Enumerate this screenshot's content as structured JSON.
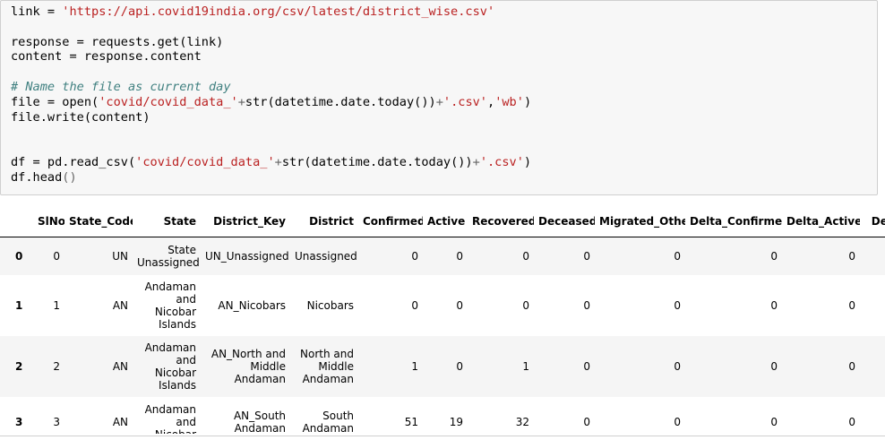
{
  "code_cell": {
    "lines": [
      [
        {
          "t": "link = ",
          "c": ""
        },
        {
          "t": "'https://api.covid19india.org/csv/latest/district_wise.csv'",
          "c": "str"
        }
      ],
      [],
      [
        {
          "t": "response = requests.get(link)",
          "c": ""
        }
      ],
      [
        {
          "t": "content = response.content",
          "c": ""
        }
      ],
      [],
      [
        {
          "t": "# Name the file as current day",
          "c": "com"
        }
      ],
      [
        {
          "t": "file = open(",
          "c": ""
        },
        {
          "t": "'covid/covid_data_'",
          "c": "str"
        },
        {
          "t": "+",
          "c": "op"
        },
        {
          "t": "str(datetime.date.today())",
          "c": ""
        },
        {
          "t": "+",
          "c": "op"
        },
        {
          "t": "'.csv'",
          "c": "str"
        },
        {
          "t": ",",
          "c": ""
        },
        {
          "t": "'wb'",
          "c": "str"
        },
        {
          "t": ")",
          "c": ""
        }
      ],
      [
        {
          "t": "file.write(content)",
          "c": ""
        }
      ],
      [],
      [],
      [
        {
          "t": "df = pd.read_csv(",
          "c": ""
        },
        {
          "t": "'covid/covid_data_'",
          "c": "str"
        },
        {
          "t": "+",
          "c": "op"
        },
        {
          "t": "str(datetime.date.today())",
          "c": ""
        },
        {
          "t": "+",
          "c": "op"
        },
        {
          "t": "'.csv'",
          "c": "str"
        },
        {
          "t": ")",
          "c": ""
        }
      ],
      [
        {
          "t": "df.head",
          "c": ""
        },
        {
          "t": "()",
          "c": "op"
        }
      ]
    ]
  },
  "table": {
    "columns": [
      "",
      "SlNo",
      "State_Code",
      "State",
      "District_Key",
      "District",
      "Confirmed",
      "Active",
      "Recovered",
      "Deceased",
      "Migrated_Other",
      "Delta_Confirmed",
      "Delta_Active",
      "Del"
    ],
    "rows": [
      {
        "index": "0",
        "cells": [
          "0",
          "UN",
          "State Unassigned",
          "UN_Unassigned",
          "Unassigned",
          "0",
          "0",
          "0",
          "0",
          "0",
          "0",
          "0",
          ""
        ]
      },
      {
        "index": "1",
        "cells": [
          "1",
          "AN",
          "Andaman and Nicobar Islands",
          "AN_Nicobars",
          "Nicobars",
          "0",
          "0",
          "0",
          "0",
          "0",
          "0",
          "0",
          ""
        ]
      },
      {
        "index": "2",
        "cells": [
          "2",
          "AN",
          "Andaman and Nicobar Islands",
          "AN_North and Middle Andaman",
          "North and Middle Andaman",
          "1",
          "0",
          "1",
          "0",
          "0",
          "0",
          "0",
          ""
        ]
      },
      {
        "index": "3",
        "cells": [
          "3",
          "AN",
          "Andaman and Nicobar",
          "AN_South Andaman",
          "South Andaman",
          "51",
          "19",
          "32",
          "0",
          "0",
          "0",
          "0",
          ""
        ]
      }
    ]
  }
}
